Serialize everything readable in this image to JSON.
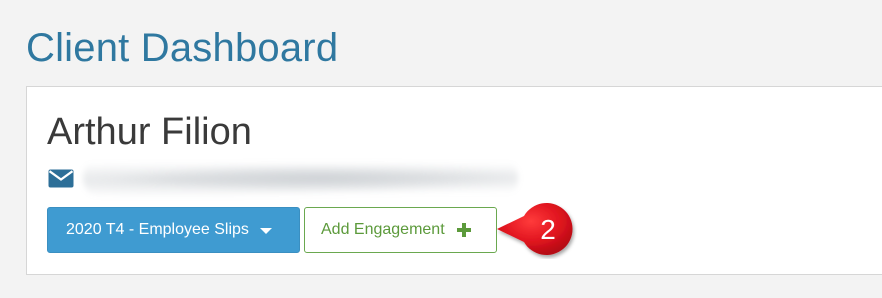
{
  "page": {
    "title": "Client Dashboard"
  },
  "client": {
    "name": "Arthur Filion",
    "email_icon": "envelope-icon"
  },
  "actions": {
    "engagement_dropdown_label": "2020 T4 - Employee Slips",
    "add_engagement_label": "Add Engagement",
    "add_icon": "plus-icon"
  },
  "annotation": {
    "step_number": "2",
    "badge_color": "#e0141f"
  },
  "colors": {
    "title": "#2f78a0",
    "primary_button": "#3f9bd1",
    "success_outline": "#6aa84f"
  }
}
